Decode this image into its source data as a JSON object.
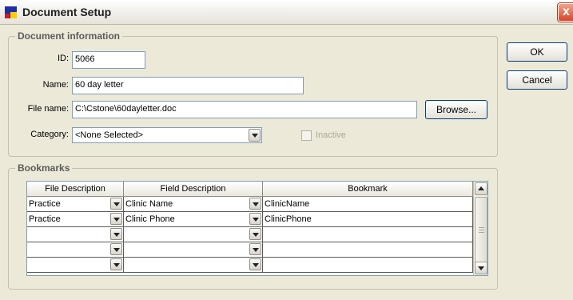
{
  "window": {
    "title": "Document Setup",
    "close_label": "x"
  },
  "doc_info": {
    "legend": "Document information",
    "id_label": "ID:",
    "id_value": "5066",
    "name_label": "Name:",
    "name_value": "60 day letter",
    "filename_label": "File name:",
    "filename_value": "C:\\Cstone\\60dayletter.doc",
    "browse_label": "Browse...",
    "category_label": "Category:",
    "category_value": "<None Selected>",
    "inactive_label": "Inactive"
  },
  "buttons": {
    "ok": "OK",
    "cancel": "Cancel"
  },
  "bookmarks": {
    "legend": "Bookmarks",
    "headers": [
      "File Description",
      "Field Description",
      "Bookmark"
    ],
    "rows": [
      {
        "file": "Practice",
        "field": "Clinic Name",
        "bookmark": "ClinicName"
      },
      {
        "file": "Practice",
        "field": "Clinic Phone",
        "bookmark": "ClinicPhone"
      },
      {
        "file": "",
        "field": "",
        "bookmark": ""
      },
      {
        "file": "",
        "field": "",
        "bookmark": ""
      },
      {
        "file": "",
        "field": "",
        "bookmark": ""
      }
    ]
  }
}
